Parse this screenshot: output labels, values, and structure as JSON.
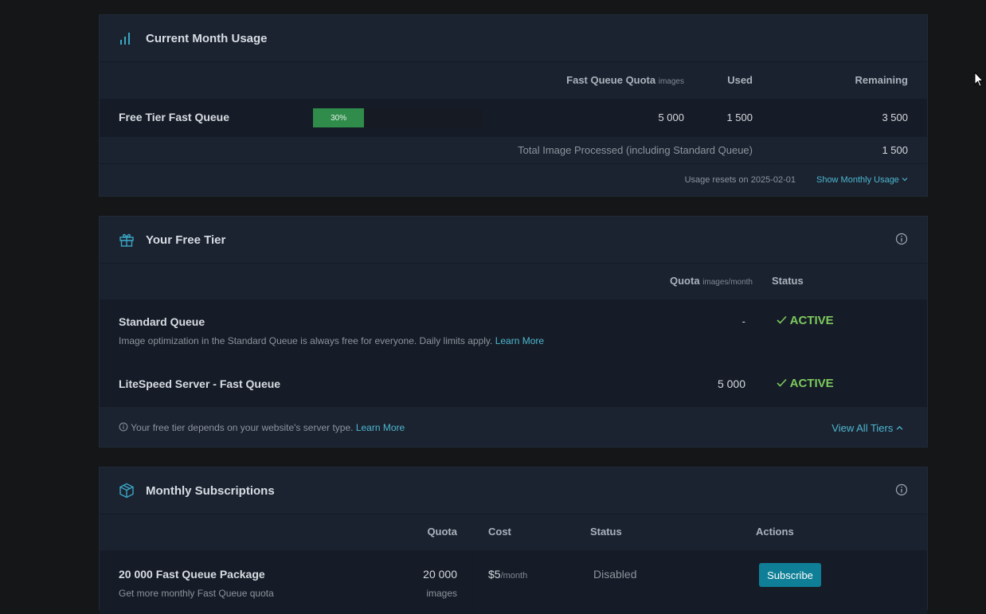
{
  "usage": {
    "title": "Current Month Usage",
    "col_quota": "Fast Queue Quota",
    "col_quota_unit": "images",
    "col_used": "Used",
    "col_remaining": "Remaining",
    "row_label": "Free Tier Fast Queue",
    "progress_percent": 30,
    "progress_label": "30%",
    "quota": "5 000",
    "used": "1 500",
    "remaining": "3 500",
    "total_label": "Total Image Processed (including Standard Queue)",
    "total_value": "1 500",
    "reset_text": "Usage resets on 2025-02-01",
    "show_monthly": "Show Monthly Usage"
  },
  "free_tier": {
    "title": "Your Free Tier",
    "col_quota": "Quota",
    "col_quota_unit": "images/month",
    "col_status": "Status",
    "rows": [
      {
        "name": "Standard Queue",
        "desc": "Image optimization in the Standard Queue is always free for everyone. Daily limits apply.",
        "link": "Learn More",
        "quota": "-",
        "status": "ACTIVE"
      },
      {
        "name": "LiteSpeed Server - Fast Queue",
        "quota": "5 000",
        "status": "ACTIVE"
      }
    ],
    "footer_text": "Your free tier depends on your website's server type.",
    "footer_link": "Learn More",
    "view_all": "View All Tiers"
  },
  "subscriptions": {
    "title": "Monthly Subscriptions",
    "col_quota": "Quota",
    "col_cost": "Cost",
    "col_status": "Status",
    "col_actions": "Actions",
    "rows": [
      {
        "name": "20 000 Fast Queue Package",
        "desc": "Get more monthly Fast Queue quota",
        "quota": "20 000",
        "quota_unit": "images",
        "cost": "$5",
        "cost_unit": "/month",
        "status": "Disabled",
        "action": "Subscribe"
      }
    ]
  },
  "colors": {
    "accent": "#4db7cf",
    "active": "#7cc95d",
    "progress": "#2f8c4a",
    "subscribe": "#0e7f96"
  }
}
